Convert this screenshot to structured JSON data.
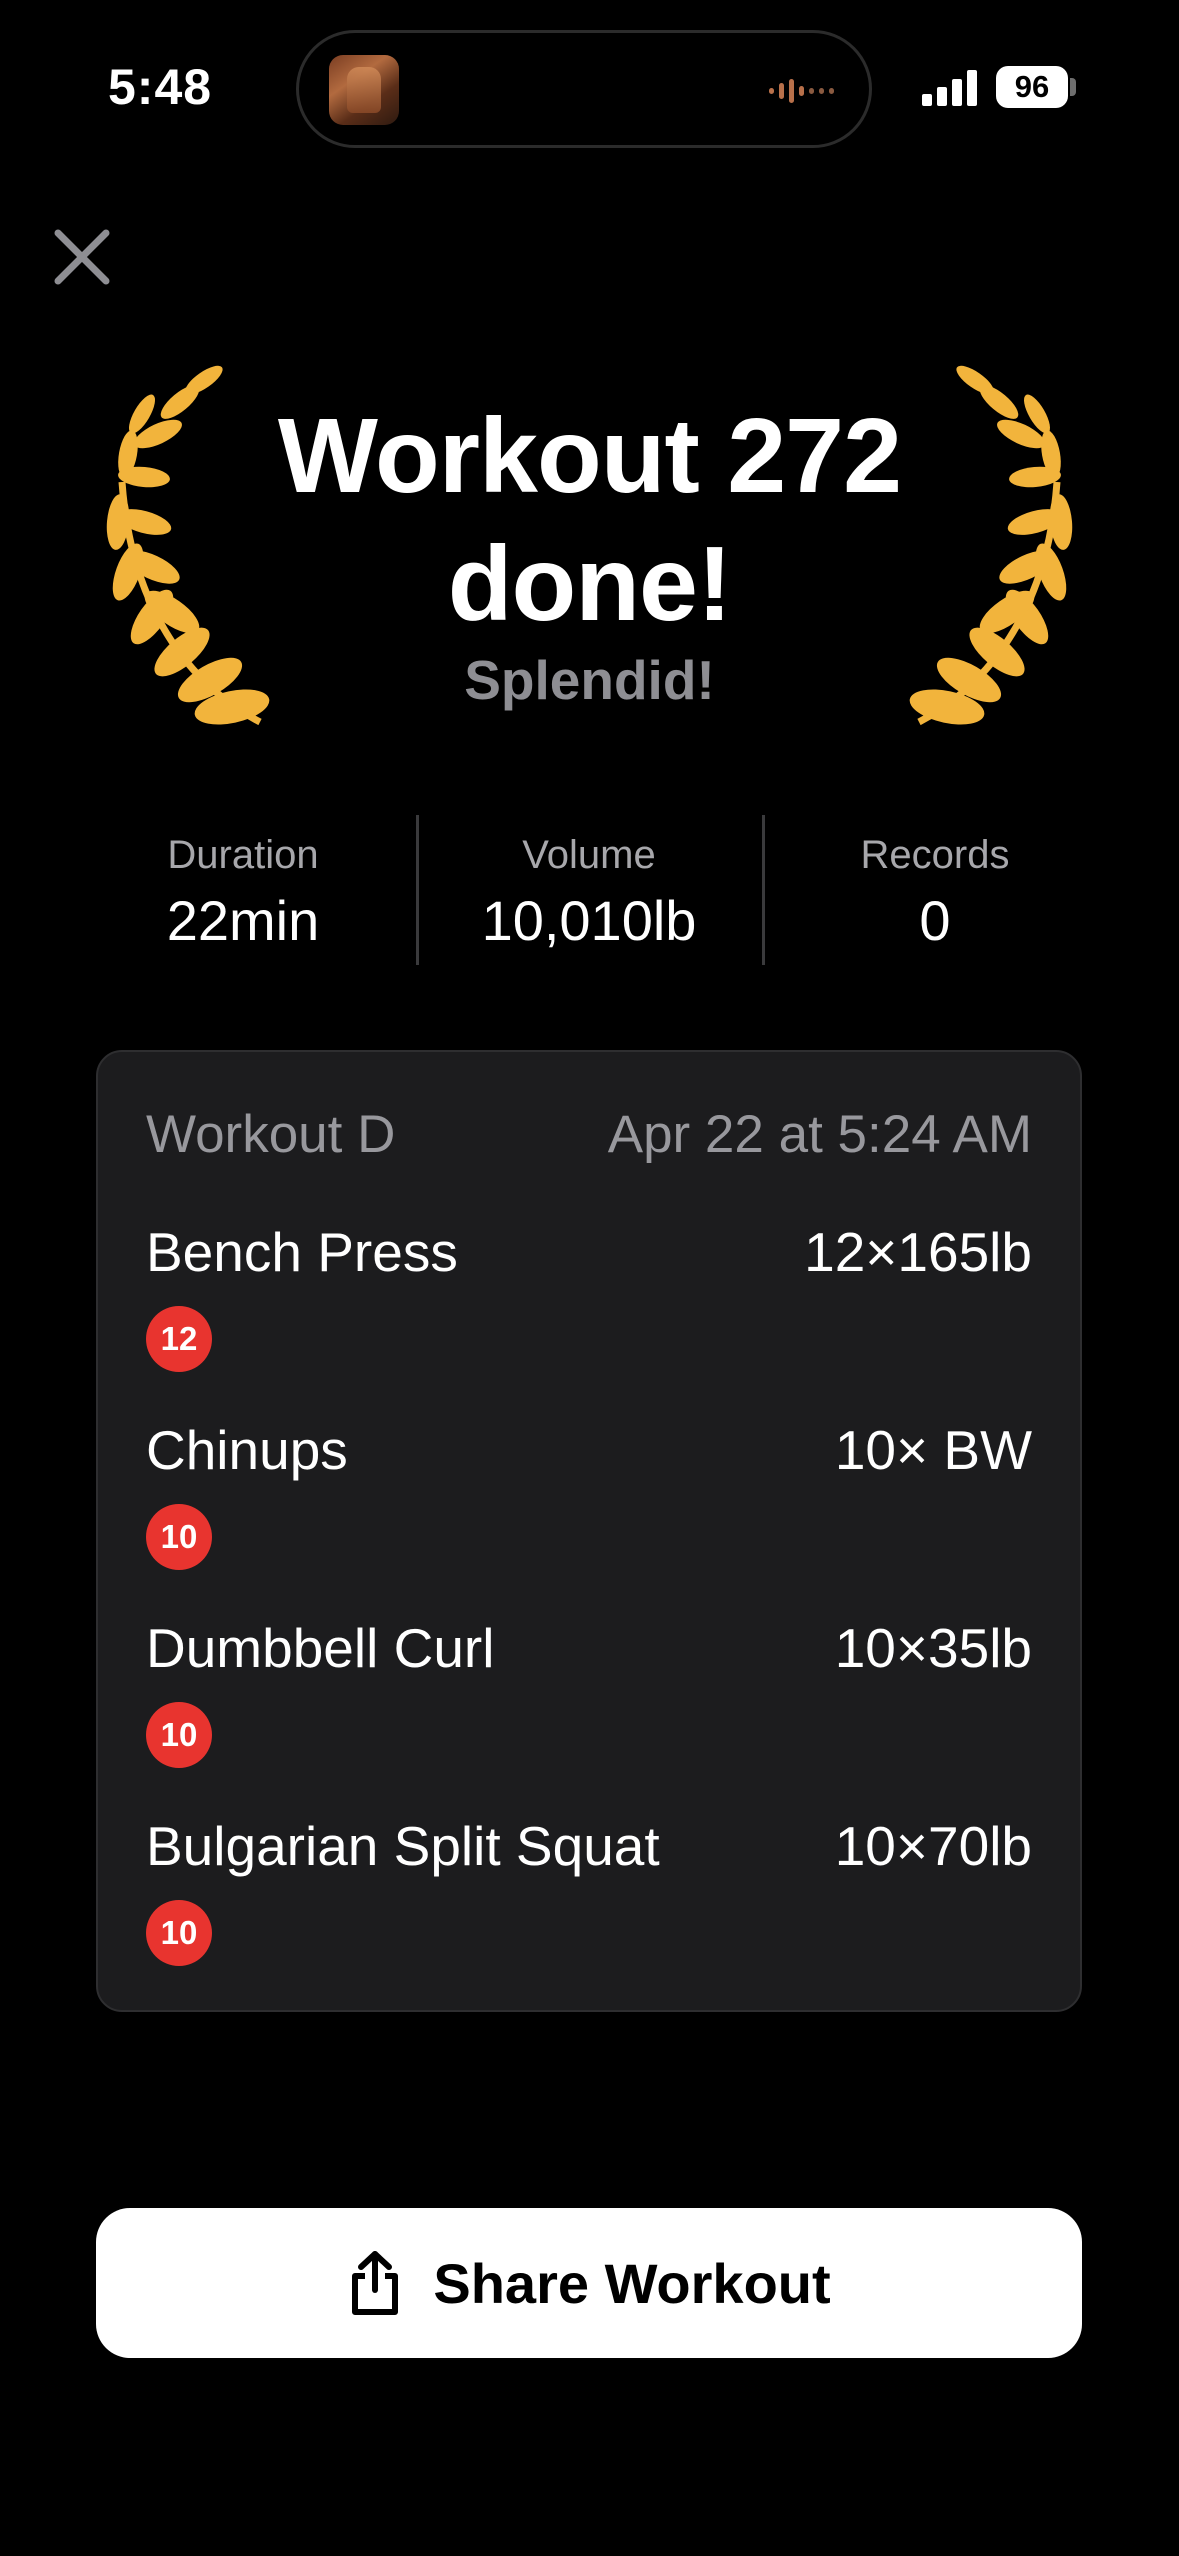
{
  "status_bar": {
    "time": "5:48",
    "battery": "96"
  },
  "header": {
    "title": "Workout 272 done!",
    "subtitle": "Splendid!"
  },
  "stats": [
    {
      "label": "Duration",
      "value": "22min"
    },
    {
      "label": "Volume",
      "value": "10,010lb"
    },
    {
      "label": "Records",
      "value": "0"
    }
  ],
  "workout": {
    "name": "Workout D",
    "date": "Apr 22 at 5:24 AM",
    "exercises": [
      {
        "name": "Bench Press",
        "sets": "12×165lb",
        "badge": "12"
      },
      {
        "name": "Chinups",
        "sets": "10× BW",
        "badge": "10"
      },
      {
        "name": "Dumbbell Curl",
        "sets": "10×35lb",
        "badge": "10"
      },
      {
        "name": "Bulgarian Split Squat",
        "sets": "10×70lb",
        "badge": "10"
      }
    ]
  },
  "share": {
    "label": "Share Workout"
  },
  "colors": {
    "background": "#000000",
    "card": "#1c1c1e",
    "laurel": "#f2b43c",
    "badge": "#e8342f",
    "secondary_text": "#98989d"
  },
  "icons": [
    "close-icon",
    "laurel-icon",
    "share-icon",
    "signal-icon",
    "battery-icon",
    "audio-wave-icon"
  ]
}
